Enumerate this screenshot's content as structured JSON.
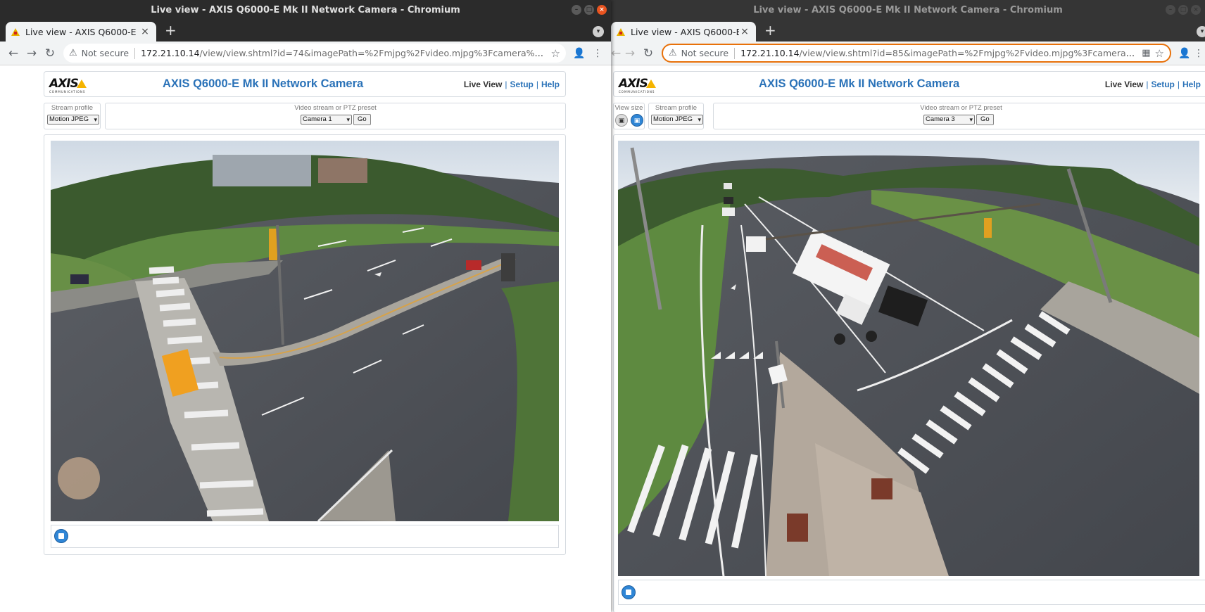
{
  "windows": [
    {
      "title": "Live view - AXIS Q6000-E Mk II Network Camera - Chromium",
      "tab_title": "Live view - AXIS Q6000-E Mk II Network Camera",
      "not_secure": "Not secure",
      "url_host": "172.21.10.14",
      "url_path": "/view/view.shtml?id=74&imagePath=%2Fmjpg%2Fvideo.mjpg%3Fcamera%3D1&si...",
      "logo": "AXIS",
      "logo_sub": "COMMUNICATIONS",
      "product_title": "AXIS Q6000-E Mk II Network Camera",
      "nav": {
        "live_view": "Live View",
        "setup": "Setup",
        "help": "Help",
        "sep": "|"
      },
      "stream_profile_caption": "Stream profile",
      "stream_profile_value": "Motion JPEG",
      "video_stream_caption": "Video stream or PTZ preset",
      "video_stream_value": "Camera 1",
      "go_label": "Go"
    },
    {
      "title": "Live view - AXIS Q6000-E Mk II Network Camera - Chromium",
      "tab_title": "Live view - AXIS Q6000-E Mk II Network Camera",
      "not_secure": "Not secure",
      "url_host": "172.21.10.14",
      "url_path": "/view/view.shtml?id=85&imagePath=%2Fmjpg%2Fvideo.mjpg%3Fcamera%3D...",
      "logo": "AXIS",
      "logo_sub": "COMMUNICATIONS",
      "product_title": "AXIS Q6000-E Mk II Network Camera",
      "nav": {
        "live_view": "Live View",
        "setup": "Setup",
        "help": "Help",
        "sep": "|"
      },
      "view_size_caption": "View size",
      "stream_profile_caption": "Stream profile",
      "stream_profile_value": "Motion JPEG",
      "video_stream_caption": "Video stream or PTZ preset",
      "video_stream_value": "Camera 3",
      "go_label": "Go"
    }
  ],
  "icons": {
    "back": "←",
    "forward": "→",
    "reload": "↻",
    "warning": "⚠",
    "star": "☆",
    "profile": "👤",
    "menu": "⋮",
    "new_tab": "+",
    "close": "×",
    "tab_search": "▾",
    "minimize": "–",
    "maximize": "□",
    "qr": "▦"
  },
  "colors": {
    "axis_blue": "#2a72b8",
    "stop_button": "#2f86d6",
    "titlebar": "#2b2b2b",
    "omnibox_focus": "#e8710a"
  }
}
